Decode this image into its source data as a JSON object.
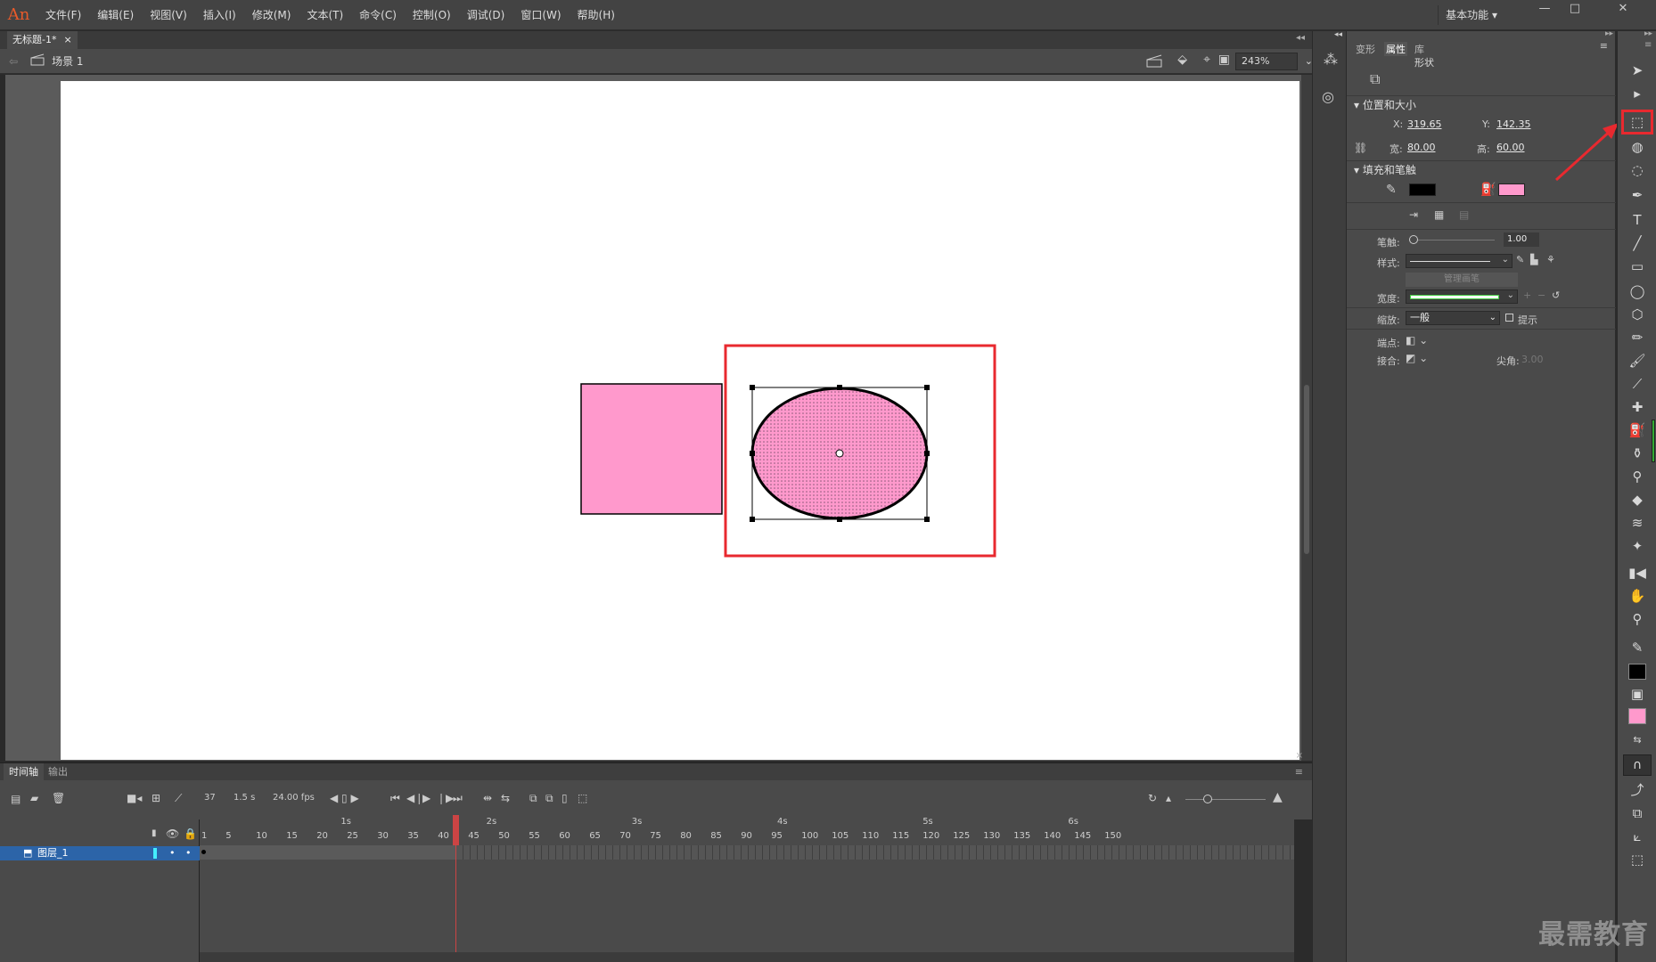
{
  "app": {
    "logo": "An",
    "menu": [
      "文件(F)",
      "编辑(E)",
      "视图(V)",
      "插入(I)",
      "修改(M)",
      "文本(T)",
      "命令(C)",
      "控制(O)",
      "调试(D)",
      "窗口(W)",
      "帮助(H)"
    ],
    "workspace": "基本功能"
  },
  "document": {
    "tab_title": "无标题-1*",
    "scene": "场景 1",
    "zoom": "243%"
  },
  "timeline": {
    "tabs": [
      "时间轴",
      "输出"
    ],
    "current_frame": "37",
    "time": "1.5 s",
    "fps": "24.00 fps",
    "seconds": [
      "1s",
      "2s",
      "3s",
      "4s",
      "5s",
      "6s"
    ],
    "frame_numbers": [
      "1",
      "5",
      "10",
      "15",
      "20",
      "25",
      "30",
      "35",
      "40",
      "45",
      "50",
      "55",
      "60",
      "65",
      "70",
      "75",
      "80",
      "85",
      "90",
      "95",
      "100",
      "105",
      "110",
      "115",
      "120",
      "125",
      "130",
      "135",
      "140",
      "145",
      "150"
    ],
    "layer_name": "图层_1"
  },
  "properties": {
    "tabs": [
      "变形",
      "属性",
      "库"
    ],
    "object_type": "形状",
    "section_position": "位置和大小",
    "x_label": "X:",
    "x_value": "319.65",
    "y_label": "Y:",
    "y_value": "142.35",
    "w_label": "宽:",
    "w_value": "80.00",
    "h_label": "高:",
    "h_value": "60.00",
    "section_fill": "填充和笔触",
    "stroke_color": "#000000",
    "fill_color": "#ff99cc",
    "stroke_label": "笔触:",
    "stroke_value": "1.00",
    "style_label": "样式:",
    "manage_brush": "管理画笔",
    "width_label": "宽度:",
    "scale_label": "缩放:",
    "scale_value": "一般",
    "hint_label": "提示",
    "cap_label": "端点:",
    "join_label": "接合:",
    "miter_label": "尖角:",
    "miter_value": "3.00"
  },
  "watermark": "最需教育"
}
